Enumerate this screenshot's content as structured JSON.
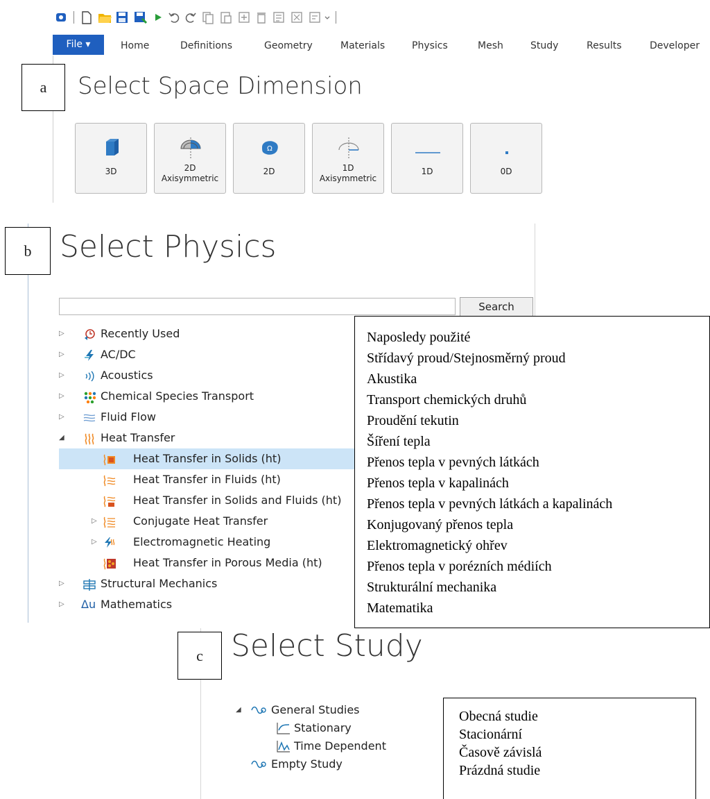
{
  "ribbon": {
    "file_label": "File ▾",
    "tabs": [
      "Home",
      "Definitions",
      "Geometry",
      "Materials",
      "Physics",
      "Mesh",
      "Study",
      "Results",
      "Developer"
    ]
  },
  "panel_a": {
    "label": "a",
    "heading": "Select Space Dimension",
    "buttons": [
      {
        "line1": "3D",
        "line2": ""
      },
      {
        "line1": "2D",
        "line2": "Axisymmetric"
      },
      {
        "line1": "2D",
        "line2": ""
      },
      {
        "line1": "1D",
        "line2": "Axisymmetric"
      },
      {
        "line1": "1D",
        "line2": ""
      },
      {
        "line1": "0D",
        "line2": ""
      }
    ]
  },
  "panel_b": {
    "label": "b",
    "heading": "Select Physics",
    "search_value": "",
    "search_button": "Search",
    "tree": [
      {
        "label": "Recently Used",
        "icon": "clock-icon"
      },
      {
        "label": "AC/DC",
        "icon": "lightning-icon"
      },
      {
        "label": "Acoustics",
        "icon": "sound-waves-icon"
      },
      {
        "label": "Chemical Species Transport",
        "icon": "dots-icon"
      },
      {
        "label": "Fluid Flow",
        "icon": "flow-lines-icon"
      },
      {
        "label": "Heat Transfer",
        "icon": "heat-icon"
      },
      {
        "label": "Heat Transfer in Solids (ht)",
        "icon": "heat-solid-icon"
      },
      {
        "label": "Heat Transfer in Fluids (ht)",
        "icon": "heat-fluid-icon"
      },
      {
        "label": "Heat Transfer in Solids and Fluids (ht)",
        "icon": "heat-solid-fluid-icon"
      },
      {
        "label": "Conjugate Heat Transfer",
        "icon": "conjugate-heat-icon"
      },
      {
        "label": "Electromagnetic Heating",
        "icon": "em-heating-icon"
      },
      {
        "label": "Heat Transfer in Porous Media (ht)",
        "icon": "porous-media-icon"
      },
      {
        "label": "Structural Mechanics",
        "icon": "structural-icon"
      },
      {
        "label": "Mathematics",
        "icon": "delta-u-icon"
      }
    ],
    "translations": [
      "Naposledy použité",
      "Střídavý proud/Stejnosměrný proud",
      "Akustika",
      "Transport chemických druhů",
      "Proudění tekutin",
      "Šíření tepla",
      "Přenos tepla v pevných látkách",
      "Přenos tepla v kapalinách",
      "Přenos tepla v pevných látkách a kapalinách",
      "Konjugovaný přenos tepla",
      "Elektromagnetický ohřev",
      "Přenos tepla v porézních médiích",
      "Strukturální mechanika",
      "Matematika"
    ]
  },
  "panel_c": {
    "label": "c",
    "heading": "Select Study",
    "tree": [
      {
        "label": "General Studies",
        "icon": "study-icon"
      },
      {
        "label": "Stationary",
        "icon": "stationary-icon"
      },
      {
        "label": "Time Dependent",
        "icon": "time-dependent-icon"
      },
      {
        "label": "Empty Study",
        "icon": "study-icon"
      }
    ],
    "translations": [
      "Obecná studie",
      "Stacionární",
      "Časově závislá",
      "Prázdná studie"
    ]
  },
  "colors": {
    "file_tab": "#1f5fbf",
    "selection": "#cce4f7",
    "heat_orange": "#f08a24",
    "icon_blue": "#1f77b4"
  }
}
